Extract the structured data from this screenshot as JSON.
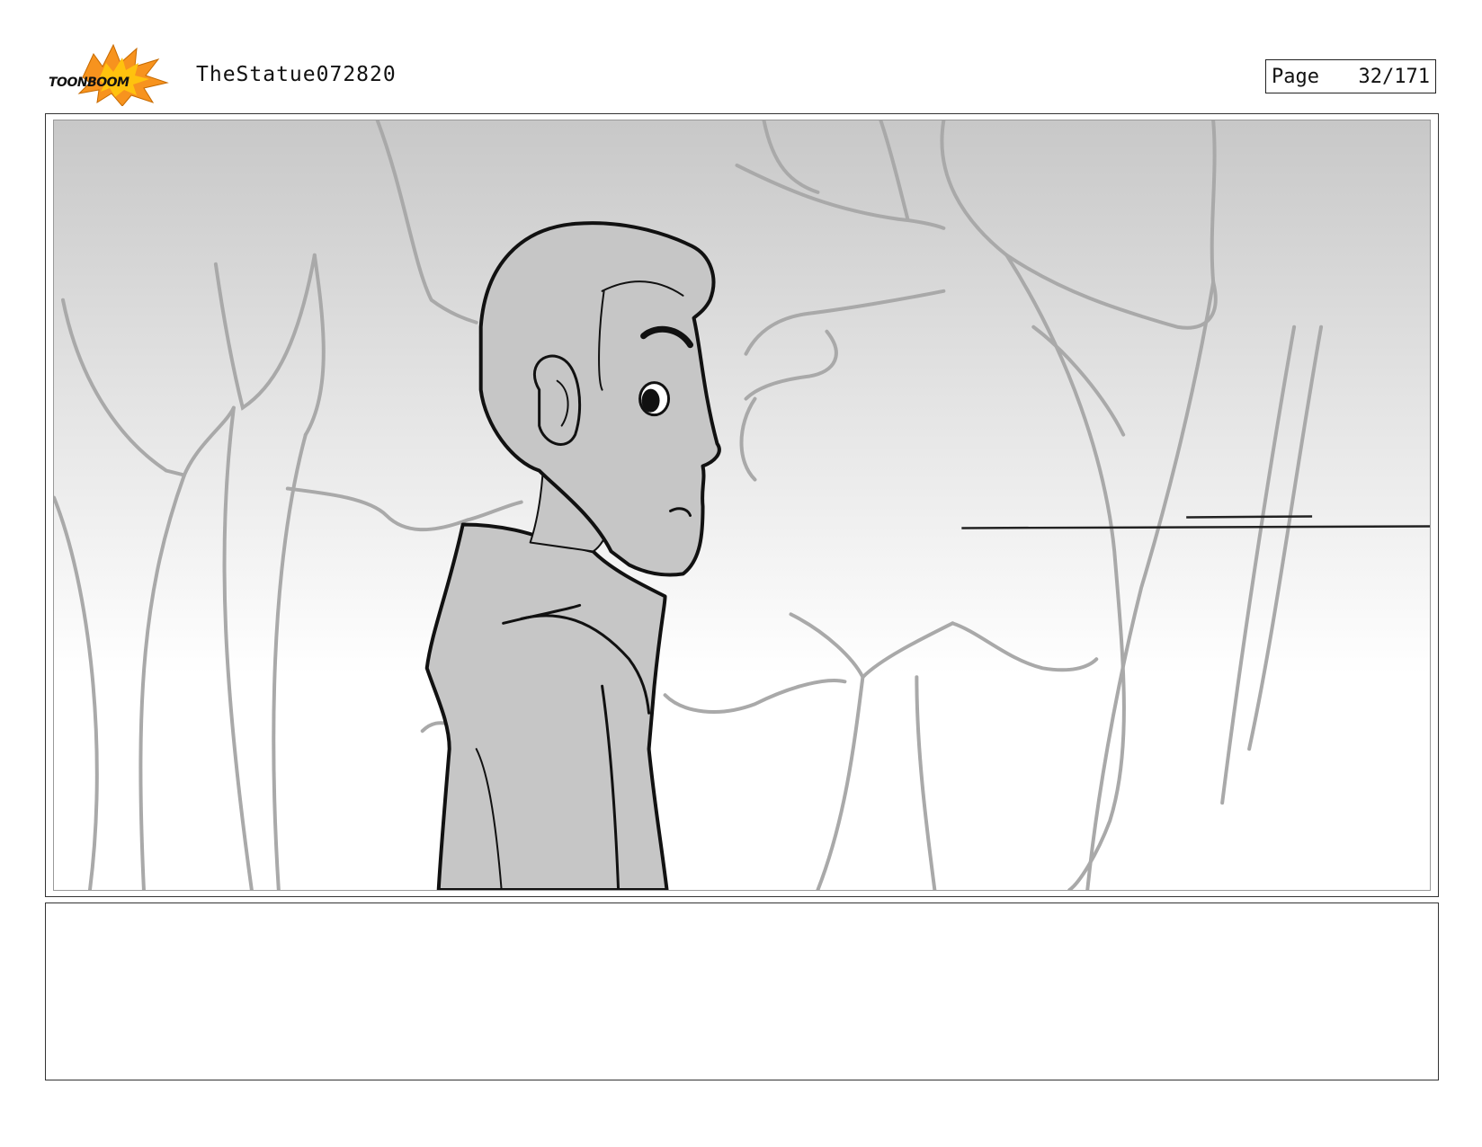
{
  "header": {
    "logo_text": "TOONBOOM",
    "logo_icon": "toonboom-logo-icon",
    "project_title": "TheStatue072820",
    "page_label": "Page",
    "page_number": "32/171"
  },
  "panel": {
    "image_icon": "storyboard-panel-sketch"
  },
  "notes": {
    "text": ""
  },
  "colors": {
    "logo_orange": "#f7931e",
    "logo_yellow": "#ffc20e",
    "sky_top": "#c8c8c8",
    "sky_bottom": "#ffffff",
    "sketch_grey": "#a9a9a9",
    "character_fill": "#c6c6c6"
  }
}
